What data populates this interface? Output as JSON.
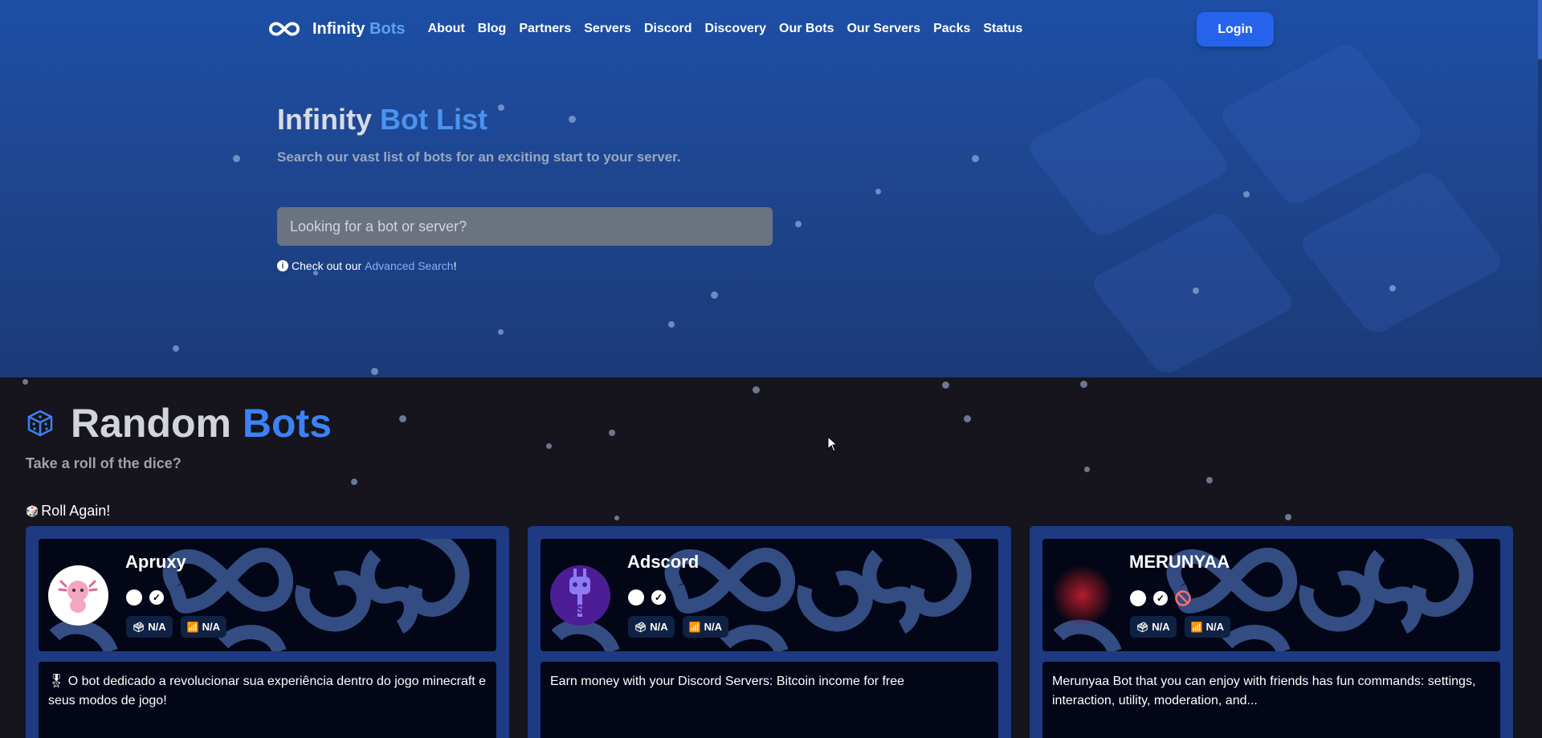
{
  "nav": {
    "brand_main": "Infinity",
    "brand_accent": "Bots",
    "links": [
      "About",
      "Blog",
      "Partners",
      "Servers",
      "Discord",
      "Discovery",
      "Our Bots",
      "Our Servers",
      "Packs",
      "Status"
    ],
    "login": "Login"
  },
  "hero": {
    "title_main": "Infinity",
    "title_accent": "Bot List",
    "subtitle": "Search our vast list of bots for an exciting start to your server.",
    "search_placeholder": "Looking for a bot or server?",
    "tip_prefix": "Check out our",
    "tip_link": "Advanced Search",
    "tip_suffix": "!"
  },
  "random": {
    "title_main": "Random",
    "title_accent": "Bots",
    "subtitle": "Take a roll of the dice?",
    "roll_label": "Roll Again!"
  },
  "cards": [
    {
      "name": "Apruxy",
      "votes": "N/A",
      "servers": "N/A",
      "banned": false,
      "description": "🎖 O bot dedicado a revolucionar sua experiência dentro do jogo minecraft e seus modos de jogo!"
    },
    {
      "name": "Adscord",
      "votes": "N/A",
      "servers": "N/A",
      "banned": false,
      "description": "Earn money with your Discord Servers: Bitcoin income for free"
    },
    {
      "name": "MERUNYAA",
      "votes": "N/A",
      "servers": "N/A",
      "banned": true,
      "description": "Merunyaa Bot that you can enjoy with friends has fun commands: settings, interaction, utility, moderation, and..."
    }
  ],
  "colors": {
    "accent": "#3b82f6",
    "hero_bg": "#1e4690",
    "page_bg": "#16141c",
    "card_bg": "#1d3a82"
  }
}
